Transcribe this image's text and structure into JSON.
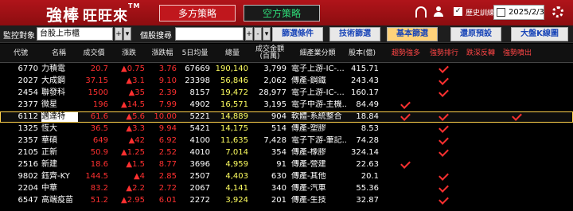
{
  "header": {
    "brand": "強棒",
    "brand_sub": "旺旺來",
    "brand_tm": "TM",
    "tab_long": "多方策略",
    "tab_short": "空方策略",
    "history_label": "歷史訓練模式",
    "history_checked": "✓",
    "date": "2025/2/3"
  },
  "toolbar": {
    "monitor_label": "監控對象",
    "monitor_value": "台股上市櫃",
    "search_label": "個股搜尋",
    "search_value": "",
    "buttons": [
      "篩選條件",
      "技術篩選",
      "基本篩選",
      "還原預設",
      "大盤K線圖"
    ]
  },
  "columns": [
    "代號",
    "名稱",
    "成交價",
    "漲跌",
    "漲跌幅",
    "5日均量",
    "總量",
    "成交金額(百萬)",
    "細產業分類",
    "股本(億)",
    "趨勢強多",
    "強勢排行",
    "跌深反轉",
    "強勢噴出"
  ],
  "rows": [
    {
      "code": "6770",
      "name": "力積電",
      "price": "20.7",
      "chg": "▲0.75",
      "pct": "3.76",
      "avg5": "67669",
      "vol": "190,140",
      "amt": "3,799",
      "ind": "電子上游-IC-...",
      "cap": "415.71",
      "checks": [
        false,
        true,
        false,
        false
      ]
    },
    {
      "code": "2027",
      "name": "大成鋼",
      "price": "37.15",
      "chg": "▲3.1",
      "pct": "9.10",
      "avg5": "23398",
      "vol": "56,846",
      "amt": "2,062",
      "ind": "傳產-鋼鐵",
      "cap": "243.43",
      "checks": [
        false,
        true,
        false,
        false
      ]
    },
    {
      "code": "2454",
      "name": "聯發科",
      "price": "1500",
      "chg": "▲35",
      "pct": "2.39",
      "avg5": "8157",
      "vol": "19,472",
      "amt": "28,977",
      "ind": "電子上游-IC-...",
      "cap": "160.17",
      "checks": [
        false,
        true,
        false,
        false
      ]
    },
    {
      "code": "2377",
      "name": "微星",
      "price": "196",
      "chg": "▲14.5",
      "pct": "7.99",
      "avg5": "4902",
      "vol": "16,571",
      "amt": "3,195",
      "ind": "電子中游-主機...",
      "cap": "84.49",
      "checks": [
        true,
        false,
        false,
        false
      ]
    },
    {
      "code": "6112",
      "name": "邁達特",
      "price": "61.6",
      "chg": "▲5.6",
      "pct": "10.00",
      "avg5": "5221",
      "vol": "14,889",
      "amt": "904",
      "ind": "軟體-系統整合",
      "cap": "18.84",
      "checks": [
        true,
        true,
        false,
        true
      ],
      "highlight": true
    },
    {
      "code": "1325",
      "name": "恆大",
      "price": "36.5",
      "chg": "▲3.3",
      "pct": "9.94",
      "avg5": "5421",
      "vol": "14,175",
      "amt": "514",
      "ind": "傳產-塑膠",
      "cap": "8.53",
      "checks": [
        false,
        true,
        false,
        false
      ]
    },
    {
      "code": "2357",
      "name": "華碩",
      "price": "649",
      "chg": "▲42",
      "pct": "6.92",
      "avg5": "4100",
      "vol": "11,635",
      "amt": "7,428",
      "ind": "電子下游-筆記...",
      "cap": "74.28",
      "checks": [
        false,
        true,
        false,
        false
      ]
    },
    {
      "code": "2105",
      "name": "正新",
      "price": "50.9",
      "chg": "▲1.25",
      "pct": "2.52",
      "avg5": "4010",
      "vol": "7,014",
      "amt": "354",
      "ind": "傳產-橡膠",
      "cap": "324.14",
      "checks": [
        false,
        true,
        false,
        false
      ]
    },
    {
      "code": "2516",
      "name": "新建",
      "price": "18.6",
      "chg": "▲1.5",
      "pct": "8.77",
      "avg5": "3696",
      "vol": "4,959",
      "amt": "91",
      "ind": "傳產-營建",
      "cap": "22.63",
      "checks": [
        true,
        false,
        false,
        false
      ]
    },
    {
      "code": "9802",
      "name": "鈺齊-KY",
      "price": "144.5",
      "chg": "▲4",
      "pct": "2.85",
      "avg5": "2507",
      "vol": "4,403",
      "amt": "630",
      "ind": "傳產-其他",
      "cap": "20.1",
      "checks": [
        false,
        true,
        false,
        false
      ]
    },
    {
      "code": "2204",
      "name": "中華",
      "price": "83.2",
      "chg": "▲2.2",
      "pct": "2.72",
      "avg5": "2067",
      "vol": "4,141",
      "amt": "340",
      "ind": "傳產-汽車",
      "cap": "55.36",
      "checks": [
        false,
        true,
        false,
        false
      ]
    },
    {
      "code": "6547",
      "name": "高端疫苗",
      "price": "51.2",
      "chg": "▲2.95",
      "pct": "6.01",
      "avg5": "2272",
      "vol": "3,924",
      "amt": "201",
      "ind": "傳產-生技",
      "cap": "32.87",
      "checks": [
        false,
        true,
        false,
        false
      ]
    }
  ],
  "colors": {
    "up": "#ff3030",
    "volume": "#ffff60",
    "highlight_border": "#ffd24d",
    "header_red": "#b0141a"
  }
}
